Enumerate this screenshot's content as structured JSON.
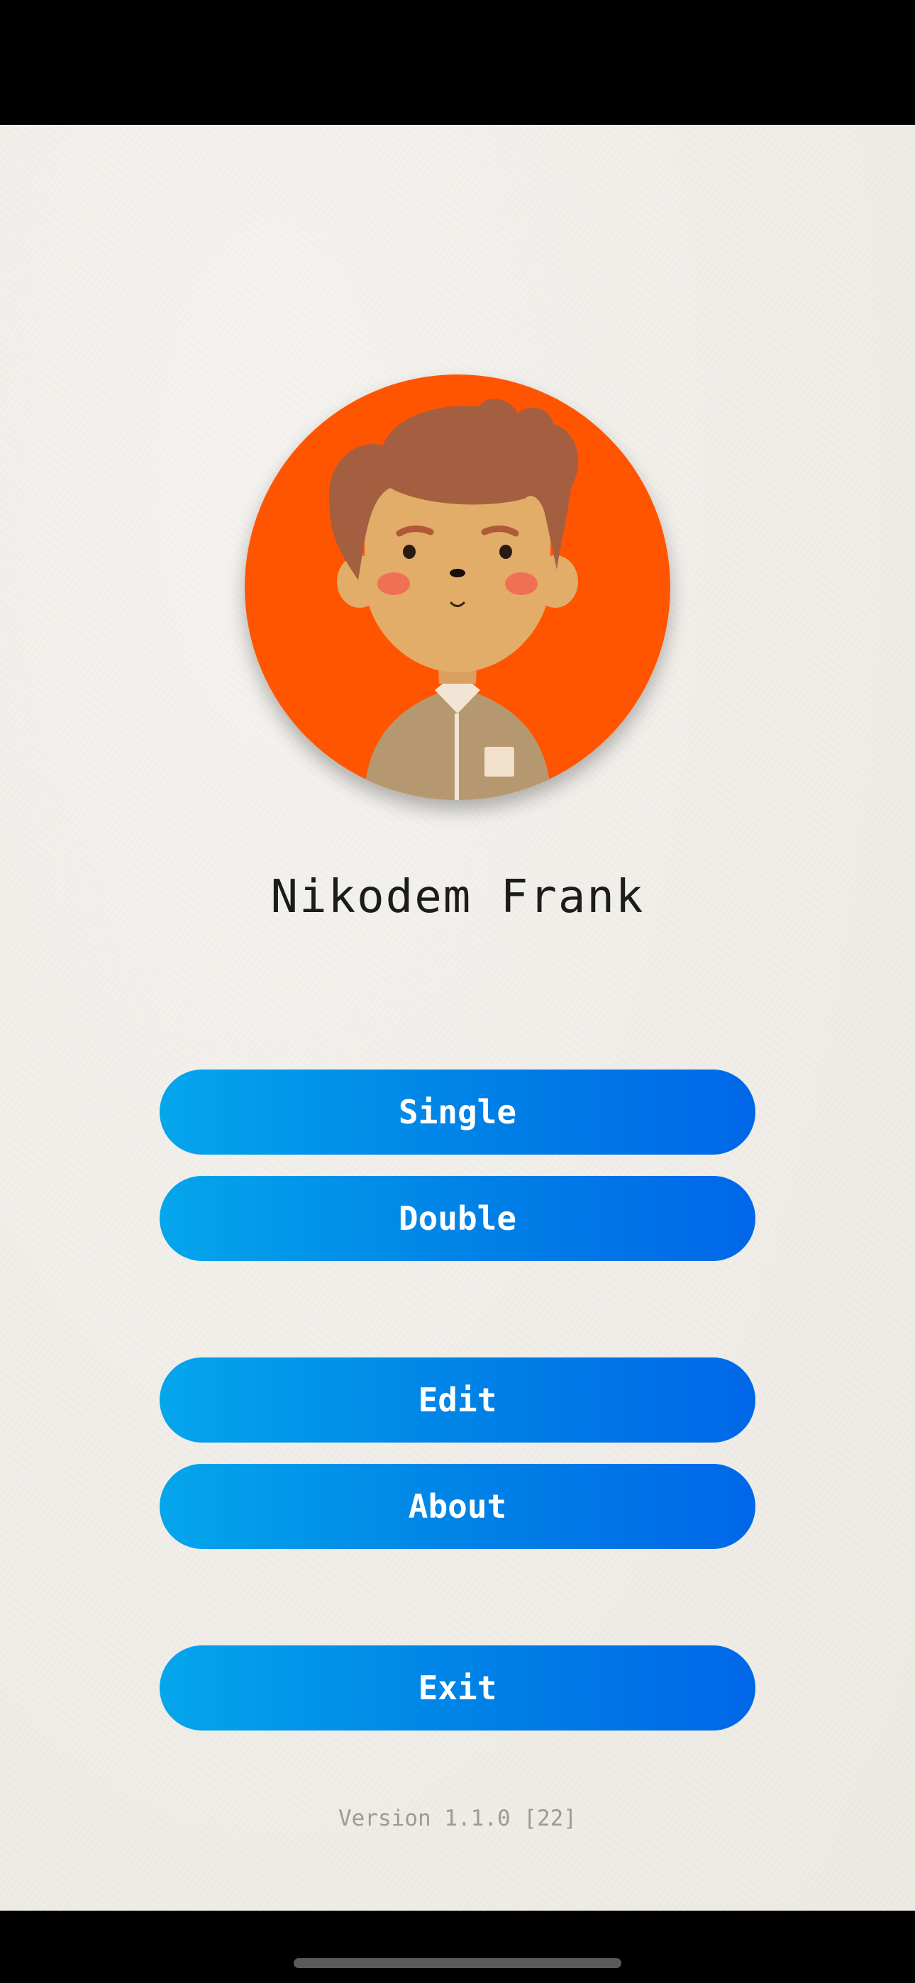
{
  "profile": {
    "name": "Nikodem Frank",
    "avatar_icon": "boy-avatar-icon",
    "avatar_bg_color": "#ff5500"
  },
  "menu": {
    "single_label": "Single",
    "double_label": "Double",
    "edit_label": "Edit",
    "about_label": "About",
    "exit_label": "Exit"
  },
  "footer": {
    "version": "Version 1.1.0 [22]"
  },
  "colors": {
    "button_start": "#04a6ec",
    "button_end": "#0067e8",
    "background": "#f1eeea"
  }
}
